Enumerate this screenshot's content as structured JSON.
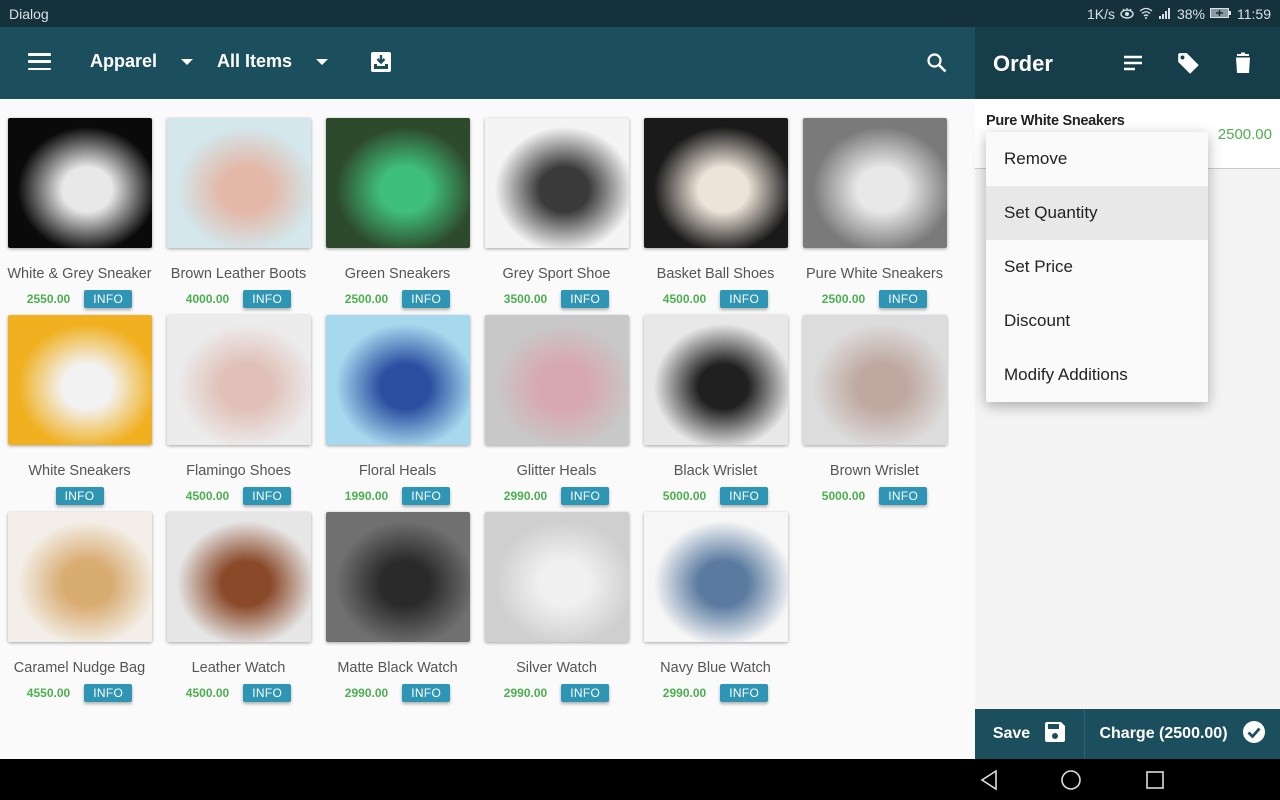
{
  "status_bar": {
    "app_label": "Dialog",
    "net_speed": "1K/s",
    "battery": "38%",
    "time": "11:59"
  },
  "toolbar": {
    "category_selected": "Apparel",
    "filter_selected": "All Items"
  },
  "order_panel": {
    "title": "Order",
    "items": [
      {
        "name": "Pure White Sneakers",
        "price": "2500.00"
      }
    ],
    "context_menu": [
      {
        "label": "Remove",
        "highlighted": false
      },
      {
        "label": "Set Quantity",
        "highlighted": true
      },
      {
        "label": "Set Price",
        "highlighted": false
      },
      {
        "label": "Discount",
        "highlighted": false
      },
      {
        "label": "Modify Additions",
        "highlighted": false
      }
    ],
    "save_label": "Save",
    "charge_label": "Charge (2500.00)"
  },
  "info_label": "INFO",
  "products": [
    {
      "name": "White & Grey Sneaker",
      "price": "2550.00",
      "colors": [
        "#0a0a0a",
        "#e8e8e8"
      ]
    },
    {
      "name": "Brown Leather Boots",
      "price": "4000.00",
      "colors": [
        "#d3e7ec",
        "#e3b8a8"
      ]
    },
    {
      "name": "Green Sneakers",
      "price": "2500.00",
      "colors": [
        "#2d4a2c",
        "#3fc07a"
      ]
    },
    {
      "name": "Grey Sport Shoe",
      "price": "3500.00",
      "colors": [
        "#f4f4f4",
        "#3a3a3a"
      ]
    },
    {
      "name": "Basket Ball Shoes",
      "price": "4500.00",
      "colors": [
        "#1a1a1a",
        "#ede4d9"
      ]
    },
    {
      "name": "Pure White Sneakers",
      "price": "2500.00",
      "colors": [
        "#7a7a7a",
        "#e8e8e8"
      ]
    },
    {
      "name": "White Sneakers",
      "price": "",
      "colors": [
        "#f0b020",
        "#f2f2f2"
      ]
    },
    {
      "name": "Flamingo Shoes",
      "price": "4500.00",
      "colors": [
        "#ececec",
        "#e0c0b8"
      ]
    },
    {
      "name": "Floral Heals",
      "price": "1990.00",
      "colors": [
        "#a6d8ee",
        "#2a4fa0"
      ]
    },
    {
      "name": "Glitter Heals",
      "price": "2990.00",
      "colors": [
        "#c8c8c8",
        "#d8a8b0"
      ]
    },
    {
      "name": "Black Wrislet",
      "price": "5000.00",
      "colors": [
        "#e8e8e8",
        "#202020"
      ]
    },
    {
      "name": "Brown Wrislet",
      "price": "5000.00",
      "colors": [
        "#dcdcdc",
        "#bfa8a0"
      ]
    },
    {
      "name": "Caramel Nudge Bag",
      "price": "4550.00",
      "colors": [
        "#f3efe8",
        "#d9ac72"
      ]
    },
    {
      "name": "Leather Watch",
      "price": "4500.00",
      "colors": [
        "#e6e6e6",
        "#8a4a2a"
      ]
    },
    {
      "name": "Matte Black Watch",
      "price": "2990.00",
      "colors": [
        "#707070",
        "#2a2a2a"
      ]
    },
    {
      "name": "Silver Watch",
      "price": "2990.00",
      "colors": [
        "#cfcfcf",
        "#f0f0f0"
      ]
    },
    {
      "name": "Navy Blue Watch",
      "price": "2990.00",
      "colors": [
        "#f6f6f6",
        "#5a7aa0"
      ]
    }
  ]
}
